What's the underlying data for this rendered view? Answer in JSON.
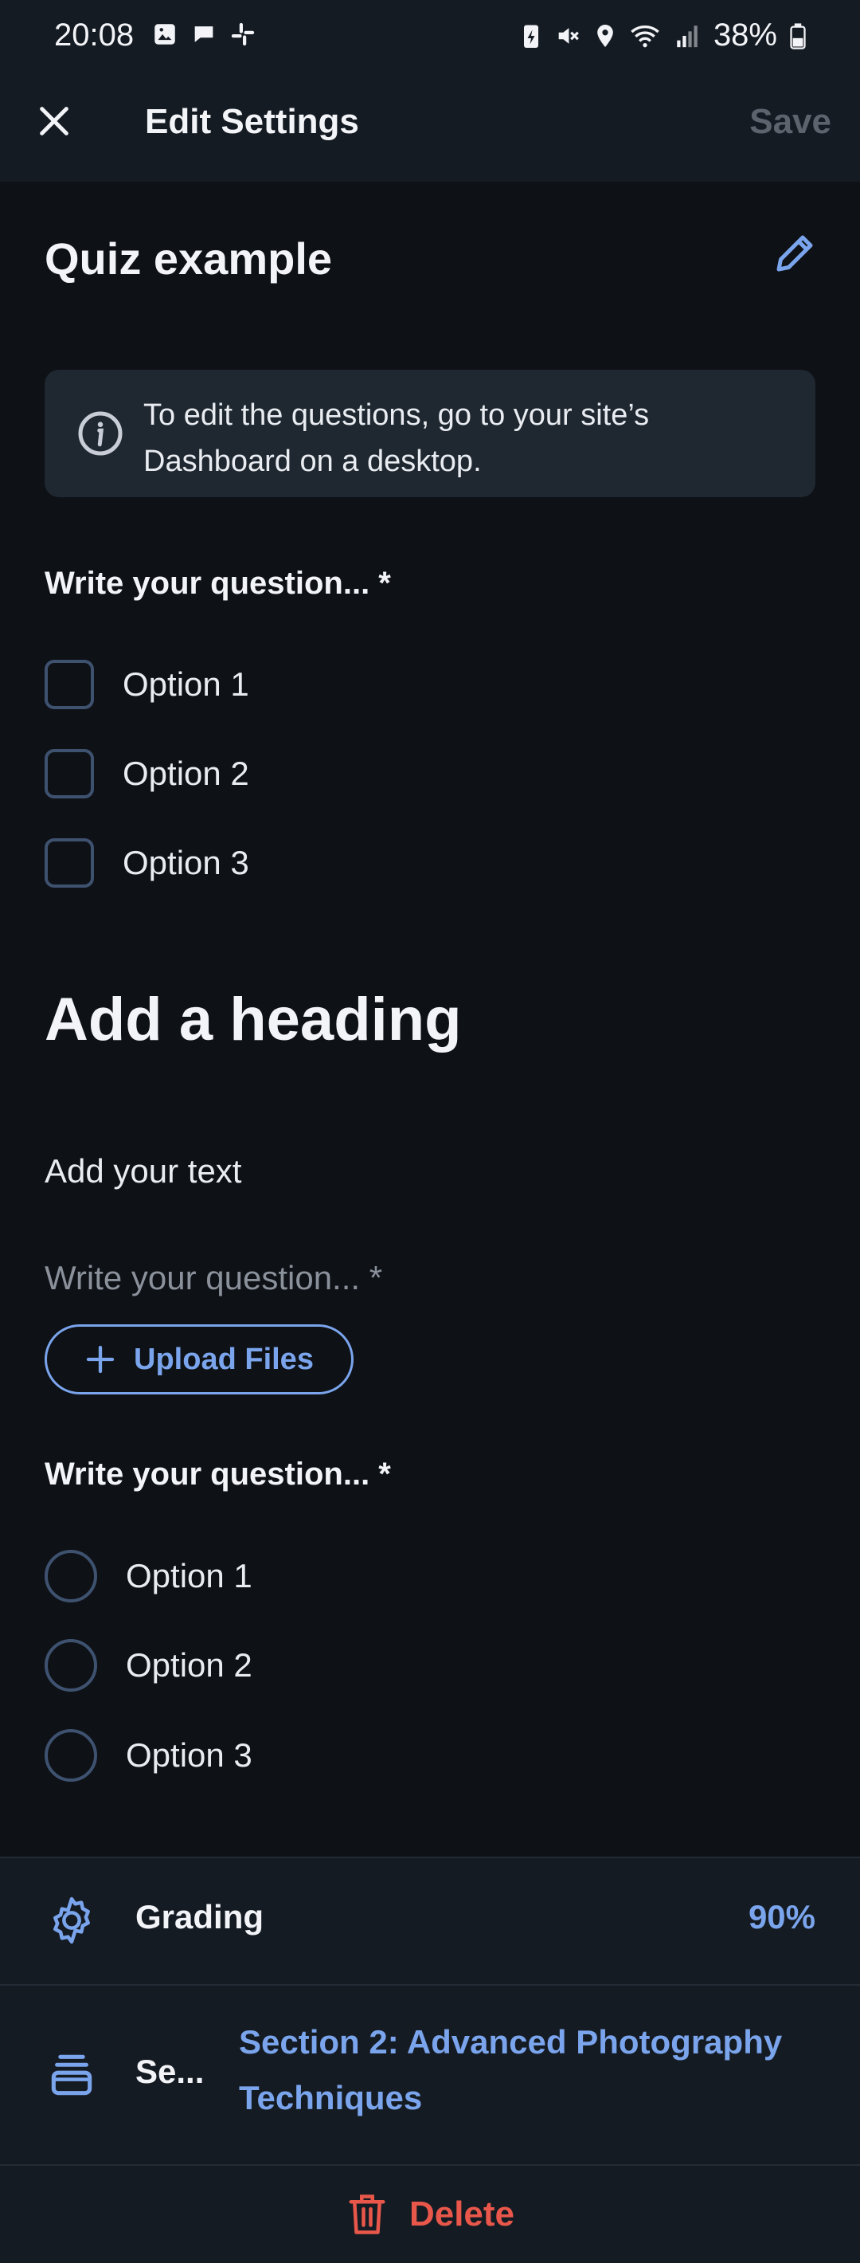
{
  "status_bar": {
    "time": "20:08",
    "battery": "38%",
    "left_icons": [
      "image-icon",
      "chat-icon",
      "slack-icon"
    ],
    "right_icons": [
      "battery-saver-icon",
      "mute-icon",
      "location-icon",
      "wifi-icon",
      "signal-icon",
      "battery-icon"
    ]
  },
  "app_bar": {
    "title": "Edit Settings",
    "save_label": "Save"
  },
  "quiz": {
    "title": "Quiz example",
    "info_text": "To edit the questions, go to your site’s Dashboard on a desktop."
  },
  "question_1": {
    "label": "Write your question... *",
    "options": [
      "Option 1",
      "Option 2",
      "Option 3"
    ]
  },
  "heading_block": {
    "heading": "Add a heading",
    "text": "Add your text"
  },
  "question_2": {
    "placeholder": "Write your question... *",
    "upload_label": "Upload Files"
  },
  "question_3": {
    "label": "Write your question... *",
    "options": [
      "Option 1",
      "Option 2",
      "Option 3"
    ]
  },
  "grading": {
    "label": "Grading",
    "value": "90%"
  },
  "section": {
    "label": "Se...",
    "value": "Section 2: Advanced Photography Techniques"
  },
  "delete": {
    "label": "Delete"
  },
  "colors": {
    "accent": "#7aa4ec",
    "danger": "#e8574a",
    "background": "#0e1116",
    "surface": "#151b23"
  }
}
